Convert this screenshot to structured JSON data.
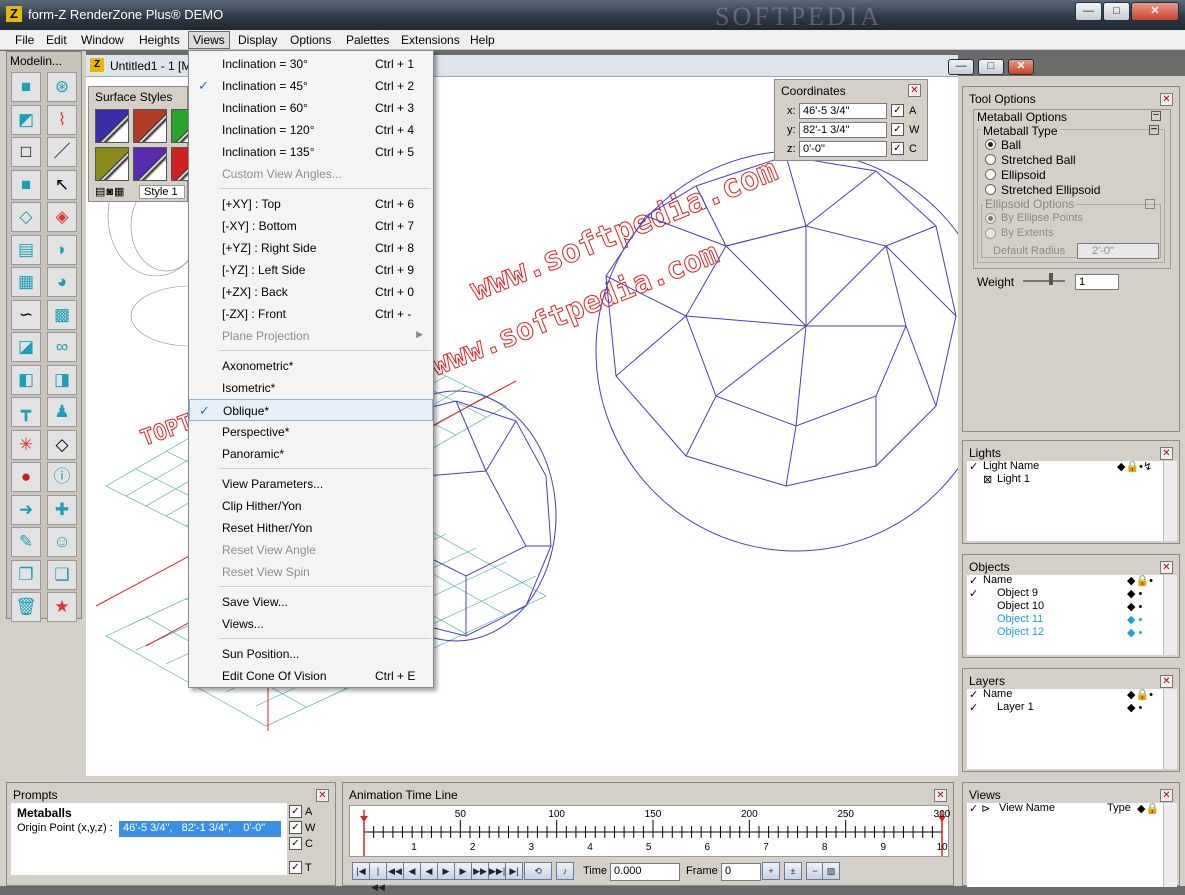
{
  "app": {
    "title": "form-Z RenderZone Plus® DEMO",
    "watermark": "SOFTPEDIA"
  },
  "window_buttons": {
    "minimize": "—",
    "maximize": "□",
    "close": "✕"
  },
  "menubar": [
    "File",
    "Edit",
    "Window",
    "Heights",
    "Views",
    "Display",
    "Options",
    "Palettes",
    "Extensions",
    "Help"
  ],
  "modeling_palette": {
    "title": "Modelin...",
    "tools": [
      "cube-tool-icon",
      "atom-tool-icon",
      "select-cube-icon",
      "path-icon",
      "rectangle-icon",
      "line-icon",
      "solid-cube-icon",
      "pointer-icon",
      "plane-icon",
      "boolean-icon",
      "stack-icon",
      "bend-icon",
      "grid-surface-icon",
      "cylinder-icon",
      "curve-icon",
      "mesh-icon",
      "split-icon",
      "link-icon",
      "extrude-icon",
      "sweep-icon",
      "t-shape-icon",
      "stamp-icon",
      "explode-icon",
      "diamond-icon",
      "sphere-icon",
      "info-icon",
      "move-icon",
      "cross-icon",
      "paint-icon",
      "ghost-icon",
      "copy-icon",
      "copy2-icon",
      "trash-icon",
      "star-icon"
    ]
  },
  "document": {
    "title": "Untitled1 - 1 [M"
  },
  "surface_styles": {
    "title": "Surface Styles",
    "style_name": "Style 1",
    "colors": [
      "#3a2ea8",
      "#b33a26",
      "#2aa42a",
      "#8a8a1a",
      "#5a2ab0",
      "#d02020"
    ]
  },
  "views_menu": {
    "items": [
      {
        "label": "Inclination = 30°",
        "shortcut": "Ctrl + 1"
      },
      {
        "label": "Inclination = 45°",
        "shortcut": "Ctrl + 2",
        "checked": true
      },
      {
        "label": "Inclination = 60°",
        "shortcut": "Ctrl + 3"
      },
      {
        "label": "Inclination = 120°",
        "shortcut": "Ctrl + 4"
      },
      {
        "label": "Inclination = 135°",
        "shortcut": "Ctrl + 5"
      },
      {
        "label": "Custom View Angles...",
        "disabled": true
      },
      {
        "label": "[+XY] : Top",
        "shortcut": "Ctrl + 6"
      },
      {
        "label": "[-XY] : Bottom",
        "shortcut": "Ctrl + 7"
      },
      {
        "label": "[+YZ] : Right Side",
        "shortcut": "Ctrl + 8"
      },
      {
        "label": "[-YZ] : Left Side",
        "shortcut": "Ctrl + 9"
      },
      {
        "label": "[+ZX] : Back",
        "shortcut": "Ctrl + 0"
      },
      {
        "label": "[-ZX] : Front",
        "shortcut": "Ctrl + -"
      },
      {
        "label": "Plane Projection",
        "disabled": true,
        "submenu": true
      },
      {
        "label": "Axonometric*"
      },
      {
        "label": "Isometric*"
      },
      {
        "label": "Oblique*",
        "checked": true,
        "selected": true
      },
      {
        "label": "Perspective*"
      },
      {
        "label": "Panoramic*"
      },
      {
        "label": "View Parameters..."
      },
      {
        "label": "Clip Hither/Yon"
      },
      {
        "label": "Reset Hither/Yon"
      },
      {
        "label": "Reset View Angle",
        "disabled": true
      },
      {
        "label": "Reset View Spin",
        "disabled": true
      },
      {
        "label": "Save View..."
      },
      {
        "label": "Views..."
      },
      {
        "label": "Sun Position..."
      },
      {
        "label": "Edit Cone Of Vision",
        "shortcut": "Ctrl + E"
      }
    ]
  },
  "coordinates": {
    "title": "Coordinates",
    "rows": [
      {
        "axis": "x:",
        "value": "46'-5 3/4\"",
        "flag": "A"
      },
      {
        "axis": "y:",
        "value": "82'-1 3/4\"",
        "flag": "W"
      },
      {
        "axis": "z:",
        "value": "0'-0\"",
        "flag": "C"
      }
    ]
  },
  "tool_options": {
    "title": "Tool Options",
    "metaball_options": "Metaball Options",
    "metaball_type": "Metaball Type",
    "types": [
      "Ball",
      "Stretched Ball",
      "Ellipsoid",
      "Stretched Ellipsoid"
    ],
    "selected_type": "Ball",
    "ellipsoid_options": "Ellipsoid Options",
    "ellipsoid_choices": [
      "By Ellipse Points",
      "By Extents"
    ],
    "default_radius_label": "Default Radius",
    "default_radius": "2'-0\"",
    "weight_label": "Weight",
    "weight": "1"
  },
  "lights": {
    "title": "Lights",
    "header": "Light Name",
    "items": [
      "Light 1"
    ]
  },
  "objects": {
    "title": "Objects",
    "header": "Name",
    "items": [
      {
        "name": "Object 9",
        "color": "#000000"
      },
      {
        "name": "Object 10",
        "color": "#000000"
      },
      {
        "name": "Object 11",
        "color": "#1ea0d8"
      },
      {
        "name": "Object 12",
        "color": "#1ea0d8"
      }
    ]
  },
  "layers": {
    "title": "Layers",
    "header": "Name",
    "items": [
      "Layer 1"
    ]
  },
  "views_panel": {
    "title": "Views",
    "col_name": "View Name",
    "col_type": "Type"
  },
  "prompts": {
    "title": "Prompts",
    "heading": "Metaballs",
    "label": "Origin Point (x,y,z) :",
    "value": "46'-5 3/4\",   82'-1 3/4\",    0'-0\"",
    "flags": [
      "A",
      "W",
      "C",
      "T"
    ]
  },
  "timeline": {
    "title": "Animation Time Line",
    "major_ticks": [
      "50",
      "100",
      "150",
      "200",
      "250",
      "300"
    ],
    "minor_ticks": [
      "1",
      "2",
      "3",
      "4",
      "5",
      "6",
      "7",
      "8",
      "9",
      "10"
    ],
    "time_label": "Time",
    "time_value": "0.000",
    "frame_label": "Frame",
    "frame_value": "0"
  },
  "canvas_text": {
    "red_text_1": "www.softpedia.com",
    "red_text_2": "www.softpedia.com",
    "red_text_3": "TOPTH"
  }
}
